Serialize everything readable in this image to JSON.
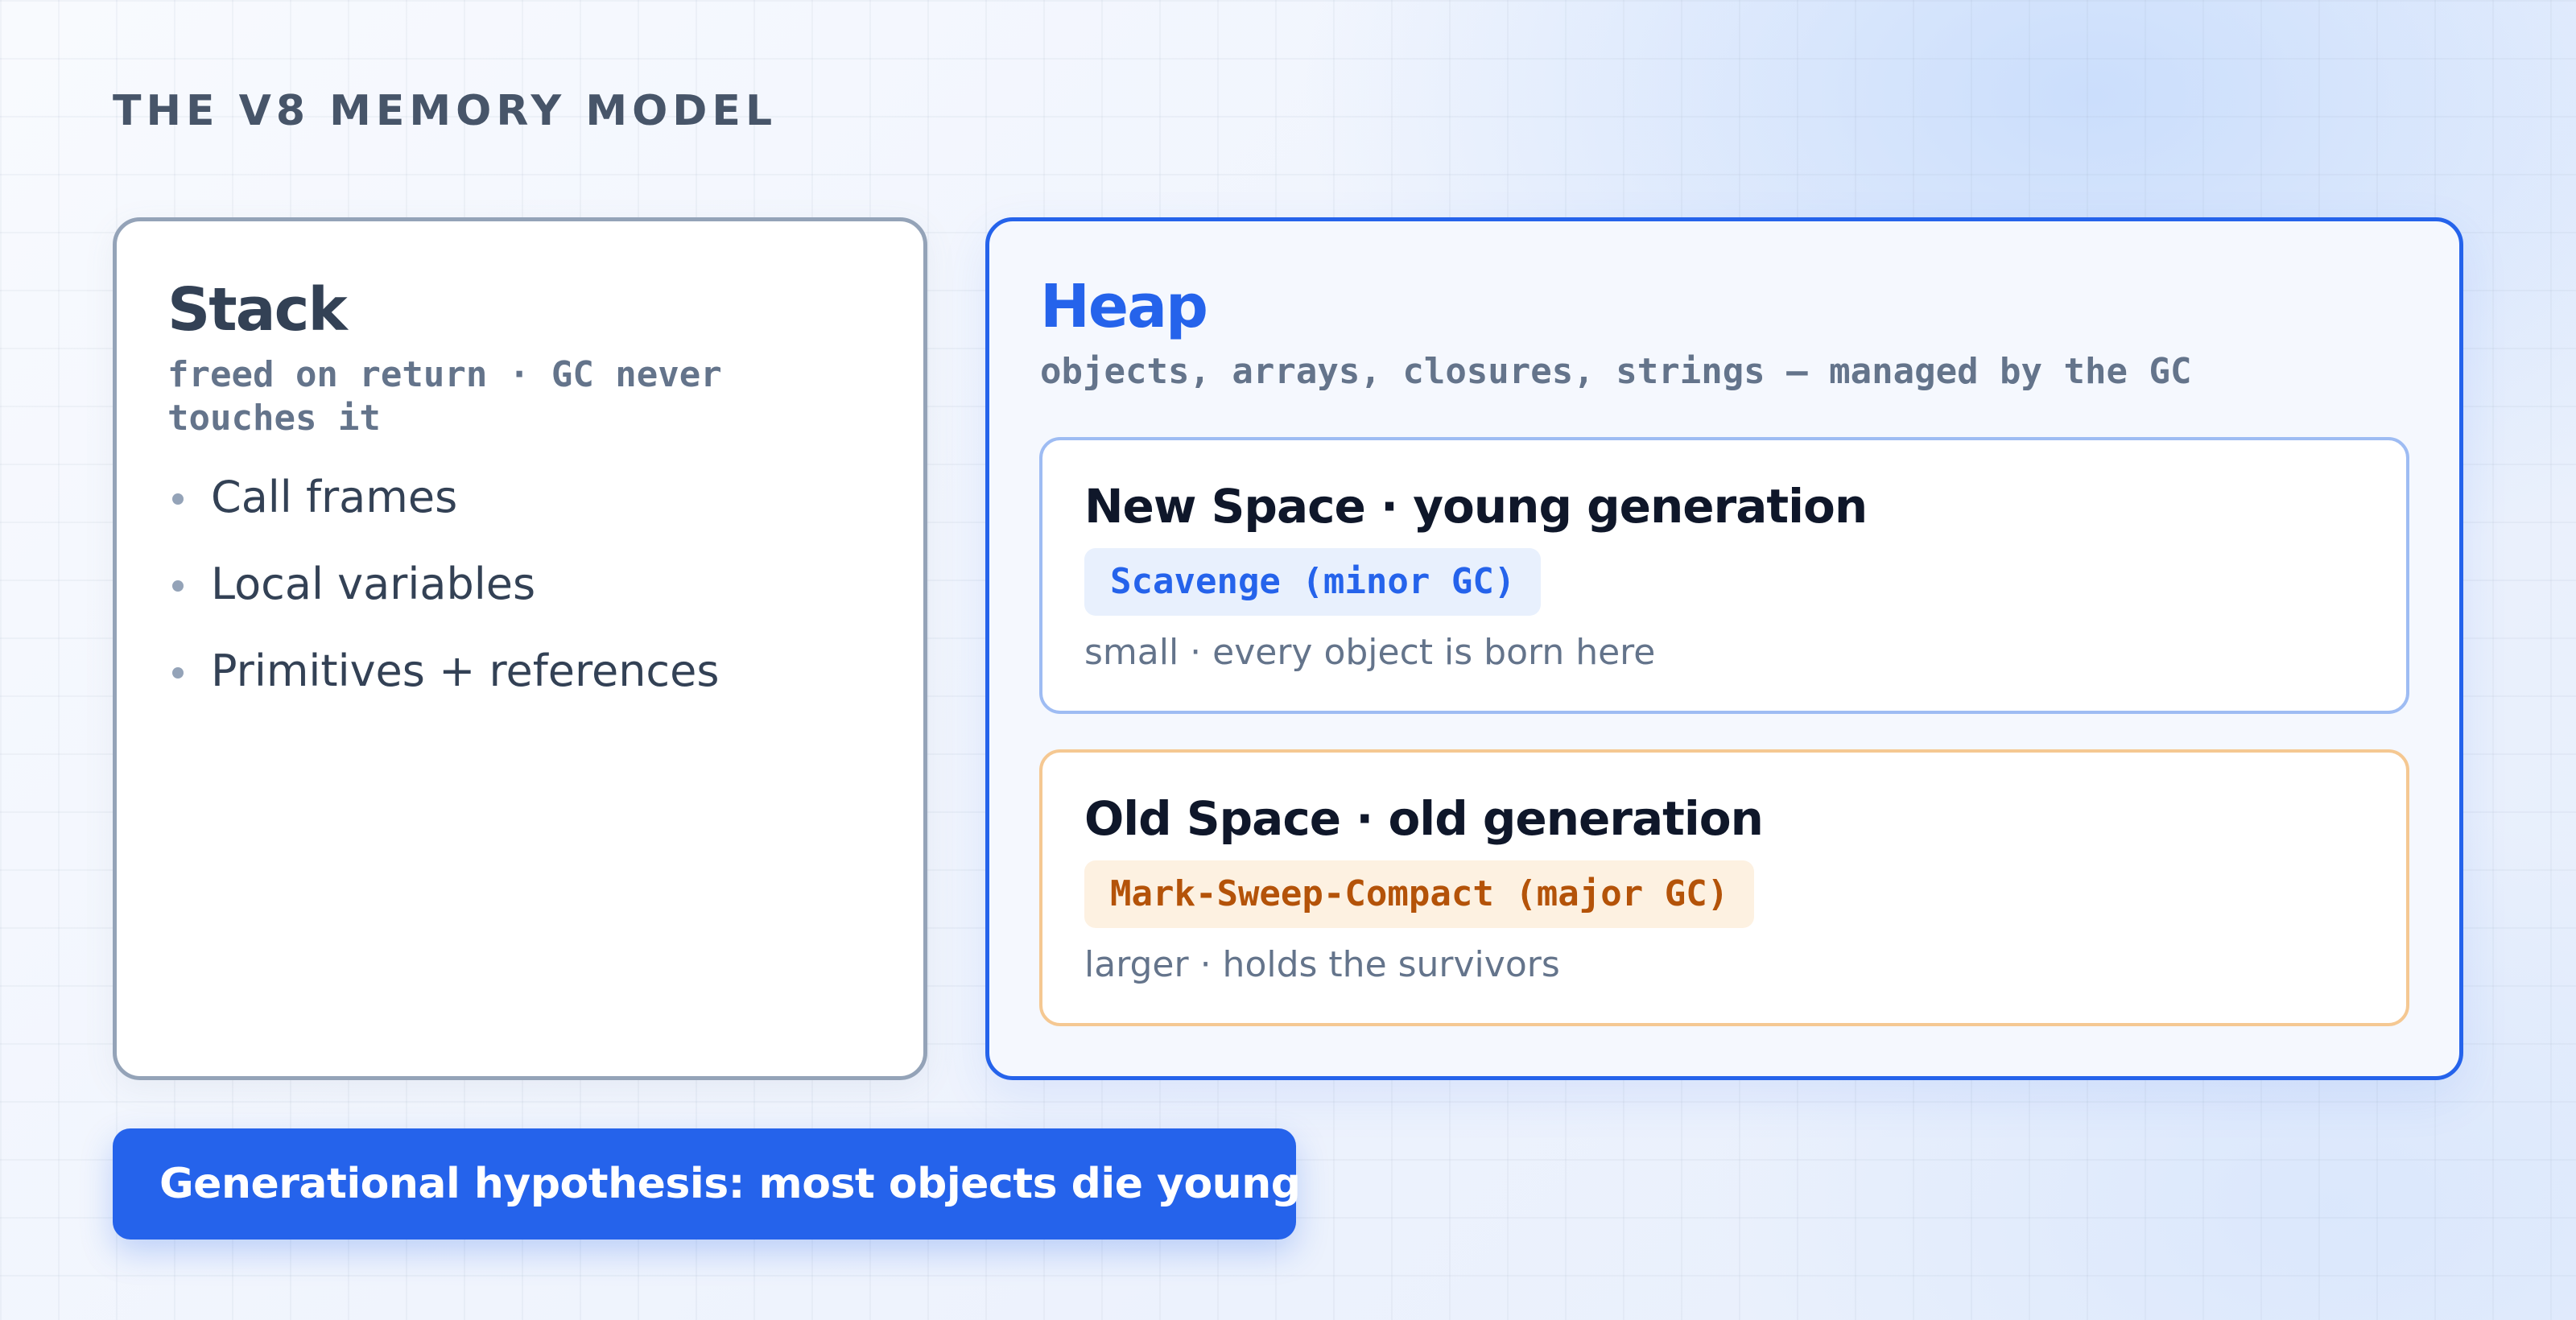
{
  "title": "THE V8 MEMORY MODEL",
  "stack": {
    "title": "Stack",
    "subtitle_line1": "freed on return · GC never",
    "subtitle_line2": "touches it",
    "items": [
      {
        "label": "Call frames"
      },
      {
        "label": "Local variables"
      },
      {
        "label": "Primitives + references"
      }
    ]
  },
  "heap": {
    "title": "Heap",
    "subtitle": "objects, arrays, closures, strings — managed by the GC",
    "new_space": {
      "title": "New Space · young generation",
      "gc": "Scavenge (minor GC)",
      "note": "small · every object is born here"
    },
    "old_space": {
      "title": "Old Space · old generation",
      "gc": "Mark-Sweep-Compact (major GC)",
      "note": "larger · holds the survivors"
    }
  },
  "callout": "Generational hypothesis: most objects die young",
  "colors": {
    "accent": "#2563eb",
    "new_space_border": "#9ebcf3",
    "old_space_border": "#f5c892",
    "minor_gc_text": "#2563eb",
    "major_gc_text": "#b45309"
  }
}
